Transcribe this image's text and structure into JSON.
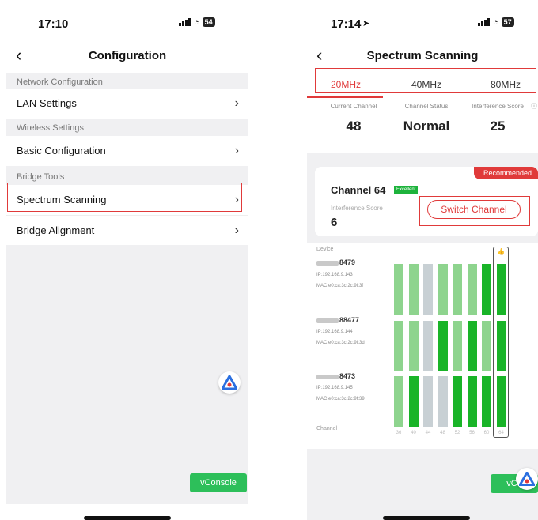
{
  "left_screen": {
    "status_time": "17:10",
    "battery": "54",
    "title": "Configuration",
    "sections": [
      {
        "header": "Network Configuration",
        "items": [
          "LAN Settings"
        ]
      },
      {
        "header": "Wireless Settings",
        "items": [
          "Basic Configuration"
        ]
      },
      {
        "header": "Bridge Tools",
        "items": [
          "Spectrum Scanning",
          "Bridge Alignment"
        ]
      }
    ],
    "vconsole": "vConsole"
  },
  "right_screen": {
    "status_time": "17:14",
    "battery": "57",
    "title": "Spectrum Scanning",
    "tabs": [
      "20MHz",
      "40MHz",
      "80MHz"
    ],
    "active_tab": "20MHz",
    "metrics": [
      {
        "label": "Current Channel",
        "value": "48"
      },
      {
        "label": "Channel Status",
        "value": "Normal"
      },
      {
        "label": "Interference Score",
        "value": "25"
      }
    ],
    "recommend": {
      "badge": "Recommended",
      "channel": "Channel 64",
      "quality": "Excellent",
      "score_label": "Interference Score",
      "score": "6",
      "button": "Switch Channel"
    },
    "device_header": "Device",
    "channel_label": "Channel",
    "devices": [
      {
        "name": "8479",
        "ip": "IP:192.168.9.143",
        "mac": "MAC:e0:ca:3c:2c:9f:3f",
        "levels": [
          "light",
          "light",
          "gray",
          "light",
          "light",
          "light",
          "dark",
          "dark"
        ]
      },
      {
        "name": "88477",
        "ip": "IP:192.168.9.144",
        "mac": "MAC:e0:ca:3c:2c:9f:3d",
        "levels": [
          "light",
          "light",
          "gray",
          "dark",
          "light",
          "dark",
          "light",
          "dark"
        ]
      },
      {
        "name": "8473",
        "ip": "IP:192.168.9.145",
        "mac": "MAC:e0:ca:3c:2c:9f:39",
        "levels": [
          "light",
          "dark",
          "gray",
          "gray",
          "dark",
          "dark",
          "dark",
          "dark"
        ]
      }
    ],
    "channels": [
      "36",
      "40",
      "44",
      "48",
      "52",
      "56",
      "60",
      "64"
    ],
    "vconsole": "vCo",
    "colors": {
      "dark": "#19b428",
      "light": "#8ed48e",
      "gray": "#c8d0d4",
      "accent": "#e03a3a"
    }
  }
}
